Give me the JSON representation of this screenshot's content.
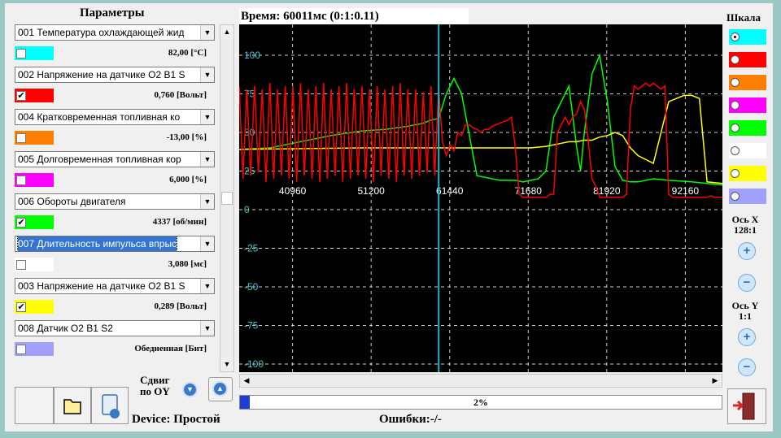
{
  "panel": {
    "title": "Параметры",
    "params": [
      {
        "name": "001 Температура охлаждающей жид",
        "color": "#00ffff",
        "checked": false,
        "value": "82,00 [°C]",
        "selected": false
      },
      {
        "name": "002 Напряжение на датчике O2 B1 S",
        "color": "#ff0000",
        "checked": true,
        "value": "0,760 [Вольт]",
        "selected": false
      },
      {
        "name": "004 Кратковременная топливная ко",
        "color": "#ff8000",
        "checked": false,
        "value": "-13,00 [%]",
        "selected": false
      },
      {
        "name": "005 Долговременная топливная кор",
        "color": "#ff00ff",
        "checked": false,
        "value": "6,000 [%]",
        "selected": false
      },
      {
        "name": "006 Обороты двигателя",
        "color": "#00ff00",
        "checked": true,
        "value": "4337 [об/мин]",
        "selected": false
      },
      {
        "name": "007 Длительность импульса впрыс",
        "color": "#ffffff",
        "checked": false,
        "value": "3,080 [мс]",
        "selected": true
      },
      {
        "name": "003 Напряжение на датчике O2 B1 S",
        "color": "#ffff00",
        "checked": true,
        "value": "0,289 [Вольт]",
        "selected": false
      },
      {
        "name": "008 Датчик O2 B1 S2",
        "color": "#a0a0ff",
        "checked": false,
        "value": "Обедненная [Бит]",
        "selected": false
      }
    ]
  },
  "time": "Время: 60011мс (0:1:0.11)",
  "chart_data": {
    "type": "line",
    "background": "#000000",
    "y_ticks": [
      "100",
      "75",
      "50",
      "25",
      "0",
      "-25",
      "-50",
      "-75",
      "-100"
    ],
    "ylim": [
      -100,
      100
    ],
    "x_ticks": [
      "40960",
      "51200",
      "61440",
      "71680",
      "81920",
      "92160"
    ],
    "xlim": [
      34000,
      97000
    ],
    "cursor_x": 60011,
    "series": [
      {
        "color": "#00ff00",
        "x": [
          34000,
          38000,
          42000,
          46000,
          50000,
          53000,
          56000,
          58000,
          59000,
          60000,
          61000,
          62000,
          63000,
          65000,
          68000,
          70000,
          71000,
          72000,
          73000,
          74000,
          75000,
          77000,
          78000,
          78500,
          79000,
          80000,
          81000,
          82000,
          83000,
          84000,
          85000,
          86000,
          87000,
          88000,
          90000,
          93000,
          95000,
          97000
        ],
        "y": [
          39,
          40,
          44,
          48,
          51,
          52,
          54,
          56,
          58,
          59,
          75,
          85,
          75,
          22,
          19,
          19,
          18,
          19,
          20,
          25,
          60,
          80,
          40,
          25,
          50,
          88,
          100,
          70,
          28,
          19,
          18,
          18,
          19,
          20,
          19,
          18,
          17,
          16
        ]
      },
      {
        "color": "#ffff00",
        "x": [
          34000,
          50000,
          60000,
          70000,
          72000,
          74000,
          75000,
          76000,
          77000,
          78000,
          79000,
          80000,
          81000,
          82000,
          83000,
          84000,
          85000,
          86000,
          88000,
          90000,
          91000,
          92000,
          93000,
          94000,
          95000,
          97000
        ],
        "y": [
          39,
          40,
          40,
          40,
          40,
          41,
          42,
          43,
          44,
          44,
          45,
          45,
          47,
          48,
          50,
          48,
          40,
          35,
          30,
          70,
          72,
          74,
          74,
          72,
          18,
          17
        ]
      },
      {
        "color": "#ff0000",
        "x": [
          34000,
          34500,
          35000,
          35500,
          36000,
          36500,
          37000,
          37500,
          38000,
          38500,
          39000,
          39500,
          40000,
          40500,
          41000,
          41500,
          42000,
          42500,
          43000,
          43500,
          44000,
          44500,
          45000,
          45500,
          46000,
          46500,
          47000,
          47500,
          48000,
          48500,
          49000,
          49500,
          50000,
          50500,
          51000,
          51500,
          52000,
          52500,
          53000,
          53500,
          54000,
          54500,
          55000,
          55500,
          56000,
          56500,
          57000,
          57500,
          58000,
          58500,
          59000,
          59500,
          60000,
          60500,
          61000,
          61500,
          62000,
          62500,
          63000,
          63500,
          64000,
          64500,
          65000,
          65500,
          66000,
          66500,
          67000,
          67500,
          68000,
          68500,
          69000,
          69500,
          70000,
          70500,
          71000,
          71500,
          72000,
          72500,
          73000,
          73500,
          74000,
          74500,
          75000,
          75500,
          76000,
          76500,
          77000,
          77500,
          78000,
          78500,
          79000,
          79500,
          80000,
          80500,
          81000,
          81500,
          82000,
          82500,
          83000,
          83500,
          84000,
          84500,
          85000,
          85500,
          86000,
          86500,
          87000,
          87500,
          88000,
          88500,
          89000,
          89500,
          90000,
          90500,
          91000,
          91500,
          92000,
          92500,
          93000,
          93500,
          94000,
          94500,
          95000,
          95500,
          96000,
          96500,
          97000
        ],
        "y": [
          80,
          20,
          78,
          22,
          80,
          24,
          78,
          18,
          82,
          20,
          78,
          22,
          80,
          20,
          80,
          18,
          82,
          22,
          78,
          20,
          80,
          18,
          82,
          20,
          78,
          22,
          80,
          18,
          82,
          20,
          78,
          22,
          80,
          20,
          78,
          18,
          80,
          22,
          78,
          20,
          80,
          18,
          82,
          22,
          78,
          20,
          78,
          22,
          76,
          24,
          80,
          22,
          78,
          44,
          35,
          42,
          38,
          50,
          48,
          55,
          55,
          53,
          52,
          50,
          52,
          52,
          54,
          55,
          56,
          57,
          58,
          60,
          40,
          10,
          8,
          8,
          8,
          8,
          8,
          8,
          8,
          10,
          10,
          50,
          55,
          60,
          55,
          60,
          62,
          70,
          65,
          45,
          20,
          15,
          8,
          8,
          8,
          8,
          8,
          8,
          8,
          10,
          65,
          80,
          78,
          80,
          82,
          80,
          82,
          80,
          78,
          80,
          10,
          8,
          8,
          8,
          8,
          8,
          8,
          8,
          8,
          8,
          8,
          9,
          8,
          8,
          8
        ]
      }
    ]
  },
  "scale": {
    "title": "Шкала",
    "items": [
      {
        "color": "#00ffff",
        "selected": true
      },
      {
        "color": "#ff0000",
        "selected": false
      },
      {
        "color": "#ff8000",
        "selected": false
      },
      {
        "color": "#ff00ff",
        "selected": false
      },
      {
        "color": "#00ff00",
        "selected": false
      },
      {
        "color": "#ffffff",
        "selected": false
      },
      {
        "color": "#ffff00",
        "selected": false
      },
      {
        "color": "#a0a0ff",
        "selected": false
      }
    ],
    "axis_x_label": "Ось X",
    "axis_x_ratio": "128:1",
    "axis_y_label": "Ось Y",
    "axis_y_ratio": "1:1"
  },
  "progress": {
    "text": "2%",
    "fraction": 0.02
  },
  "shift": {
    "line1": "Сдвиг",
    "line2": "по OY"
  },
  "device": "Device: Простой",
  "errors": "Ошибки:-/-",
  "colors": {
    "cursor": "#1fb7c8",
    "selection": "#3374d2"
  }
}
